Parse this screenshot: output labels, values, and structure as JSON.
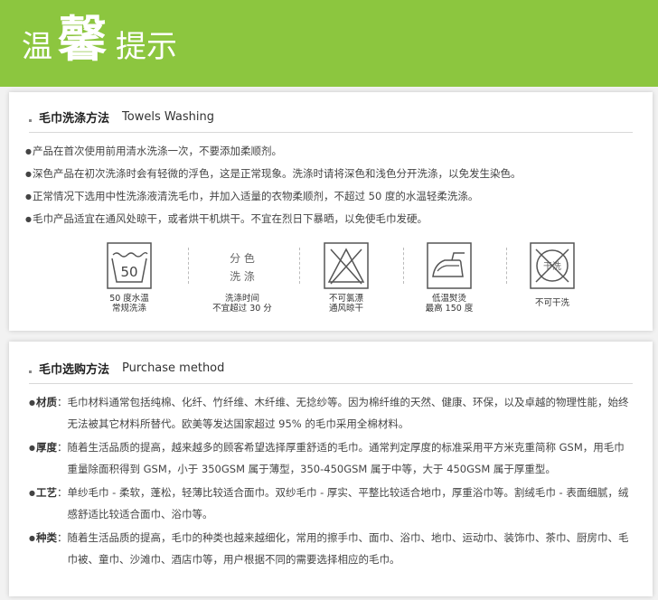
{
  "banner": {
    "part1": "温",
    "part2": "馨",
    "part3": "提示",
    "bg_color": "#8cc63f"
  },
  "washing": {
    "title_zh": "毛巾洗涤方法",
    "title_en": "Towels Washing",
    "items": [
      "产品在首次使用前用清水洗涤一次，不要添加柔顺剂。",
      "深色产品在初次洗涤时会有轻微的浮色，这是正常现象。洗涤时请将深色和浅色分开洗涤，以免发生染色。",
      "正常情况下选用中性洗涤液清洗毛巾，并加入适量的衣物柔顺剂，不超过 50 度的水温轻柔洗涤。",
      "毛巾产品适宜在通风处晾干，或者烘干机烘干。不宜在烈日下暴晒，以免使毛巾发硬。"
    ],
    "icons": [
      {
        "name": "wash-50-icon",
        "symbol_text": "50",
        "caption": [
          "50 度水温",
          "常规洗涤"
        ]
      },
      {
        "name": "wash-separately-icon",
        "symbol_text": [
          "分 色",
          "洗 涤"
        ],
        "caption": [
          "洗涤时间",
          "不宜超过 30 分"
        ]
      },
      {
        "name": "no-bleach-icon",
        "caption": [
          "不可氯漂",
          "通风晾干"
        ]
      },
      {
        "name": "low-iron-icon",
        "caption": [
          "低温熨烫",
          "最高 150 度"
        ]
      },
      {
        "name": "no-dry-clean-icon",
        "symbol_text": "干洗",
        "caption": [
          "不可干洗"
        ]
      }
    ]
  },
  "purchase": {
    "title_zh": "毛巾选购方法",
    "title_en": "Purchase method",
    "items": [
      {
        "key": "材质",
        "text": "毛巾材料通常包括纯棉、化纤、竹纤维、木纤维、无捻纱等。因为棉纤维的天然、健康、环保，以及卓越的物理性能，始终无法被其它材料所替代。欧美等发达国家超过 95% 的毛巾采用全棉材料。"
      },
      {
        "key": "厚度",
        "text": "随着生活品质的提高，越来越多的顾客希望选择厚重舒适的毛巾。通常判定厚度的标准采用平方米克重简称 GSM，用毛巾重量除面积得到 GSM，小于 350GSM 属于薄型，350-450GSM 属于中等，大于 450GSM 属于厚重型。"
      },
      {
        "key": "工艺",
        "text": "单纱毛巾 - 柔软，蓬松，轻薄比较适合面巾。双纱毛巾 - 厚实、平整比较适合地巾，厚重浴巾等。割绒毛巾 - 表面细腻，绒感舒适比较适合面巾、浴巾等。"
      },
      {
        "key": "种类",
        "text": "随着生活品质的提高，毛巾的种类也越来越细化，常用的擦手巾、面巾、浴巾、地巾、运动巾、装饰巾、茶巾、厨房巾、毛巾被、童巾、沙滩巾、酒店巾等，用户根据不同的需要选择相应的毛巾。"
      }
    ]
  }
}
